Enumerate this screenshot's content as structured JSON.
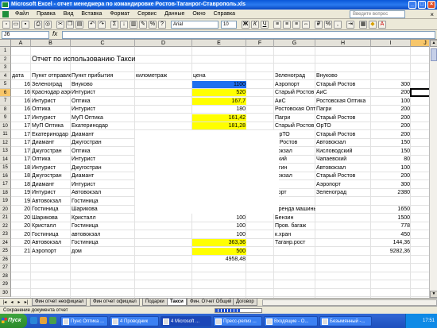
{
  "window": {
    "title": "Microsoft Excel - отчет менеджера по командировке Ростов-Таганрог-Ставрополь.xls"
  },
  "menu": {
    "items": [
      "Файл",
      "Правка",
      "Вид",
      "Вставка",
      "Формат",
      "Сервис",
      "Данные",
      "Окно",
      "Справка"
    ],
    "ask_placeholder": "Введите вопрос"
  },
  "toolbar": {
    "font": "Arial",
    "size": "10"
  },
  "formula": {
    "name_box": "J6",
    "fx": "fx"
  },
  "columns": [
    "A",
    "B",
    "C",
    "D",
    "E",
    "F",
    "G",
    "H",
    "I",
    "J"
  ],
  "rows": [
    "1",
    "2",
    "3",
    "4",
    "5",
    "6",
    "7",
    "8",
    "9",
    "10",
    "11",
    "12",
    "13",
    "14",
    "15",
    "16",
    "17",
    "18",
    "19",
    "20",
    "21",
    "22",
    "23",
    "24",
    "25",
    "26",
    "27",
    "28",
    "29",
    "30"
  ],
  "sheet": {
    "title": "Отчет по использованию Такси",
    "headers": {
      "date": "дата",
      "from": "Пункт отправление",
      "to": "Пункт прибытия",
      "km": "километраж",
      "price": "цена"
    },
    "left_rows": [
      {
        "date": "16",
        "from": "Зеленоград",
        "to": "Внуково",
        "km": "",
        "price": "1100"
      },
      {
        "date": "16",
        "from": "Краснодар аэропорт",
        "to": "Интурист",
        "km": "",
        "price": "520"
      },
      {
        "date": "16",
        "from": "Интурист",
        "to": "Оптика",
        "km": "",
        "price": "167,7"
      },
      {
        "date": "16",
        "from": "Оптика",
        "to": "Интурист",
        "km": "",
        "price": "180"
      },
      {
        "date": "17",
        "from": "Интурист",
        "to": "МуП Оптика",
        "km": "",
        "price": "161,42"
      },
      {
        "date": "17",
        "from": "МуП Оптика",
        "to": "Екатеринодар",
        "km": "",
        "price": "181,28"
      },
      {
        "date": "17",
        "from": "Екатеринодар",
        "to": "Диамант",
        "km": "",
        "price": ""
      },
      {
        "date": "17",
        "from": "Диамант",
        "to": "Джугостран",
        "km": "",
        "price": ""
      },
      {
        "date": "17",
        "from": "Джугостран",
        "to": "Оптика",
        "km": "",
        "price": ""
      },
      {
        "date": "17",
        "from": "Оптика",
        "to": "Интурист",
        "km": "",
        "price": ""
      },
      {
        "date": "18",
        "from": "Интурист",
        "to": "Джугостран",
        "km": "",
        "price": ""
      },
      {
        "date": "18",
        "from": "Джугостран",
        "to": "Диамант",
        "km": "",
        "price": ""
      },
      {
        "date": "18",
        "from": "Диамант",
        "to": "Интурист",
        "km": "",
        "price": ""
      },
      {
        "date": "19",
        "from": "Интурист",
        "to": "Автовокзал",
        "km": "",
        "price": ""
      },
      {
        "date": "19",
        "from": "Автовокзал",
        "to": "Гостиница",
        "km": "",
        "price": ""
      },
      {
        "date": "20",
        "from": "Гостиница",
        "to": "Шарикова",
        "km": "",
        "price": "100"
      },
      {
        "date": "20",
        "from": "Шарикова",
        "to": "Кристалл",
        "km": "",
        "price": "100"
      },
      {
        "date": "20",
        "from": "Кристалл",
        "to": "Гостиница",
        "km": "",
        "price": "100"
      },
      {
        "date": "20",
        "from": "Гостиница",
        "to": "автовокзал",
        "km": "",
        "price": "100"
      },
      {
        "date": "20",
        "from": "Автовокзал",
        "to": "Гостиница",
        "km": "",
        "price": "363,36"
      },
      {
        "date": "21",
        "from": "Аэропорт",
        "to": "дом",
        "km": "",
        "price": "500"
      }
    ],
    "total": "4958,48",
    "right_header": {
      "from": "Зеленоград",
      "to": "Внуково"
    },
    "right_rows": [
      {
        "from": "Аэропорт",
        "to": "Старый Ростов",
        "val": "300"
      },
      {
        "from": "Старый Ростов",
        "to": "АиС",
        "val": "200"
      },
      {
        "from": "АиС",
        "to": "Ростовская Оптика",
        "val": "100"
      },
      {
        "from": "Ростовская Оптика",
        "to": "Пагри",
        "val": "200"
      },
      {
        "from": "Пагри",
        "to": "Старый Ростов",
        "val": "200"
      },
      {
        "from": "Старый Ростов",
        "to": "ОрТО",
        "val": "200"
      },
      {
        "from": "ОрТО",
        "to": "Старый Ростов",
        "val": "200"
      },
      {
        "from": "й Ростов",
        "to": "Автовокзал",
        "val": "150"
      },
      {
        "from": "вокзал",
        "to": "Кисловодский",
        "val": "150"
      },
      {
        "from": "цкий",
        "to": "Чапаевский",
        "val": "80"
      },
      {
        "from": "ыгин",
        "to": "Автовокзал",
        "val": "100"
      },
      {
        "from": "вокзал",
        "to": "Старый Ростов",
        "val": "200"
      },
      {
        "from": "а",
        "to": "Аэропорт",
        "val": "300"
      },
      {
        "from": "порт",
        "to": "Зеленоград",
        "val": "2380"
      },
      {
        "from": "",
        "to": "",
        "val": ""
      },
      {
        "from": "Аренда машины",
        "to": "",
        "val": "1650"
      },
      {
        "from": "Бензин",
        "to": "",
        "val": "1500"
      },
      {
        "from": "Пров. багаж",
        "to": "",
        "val": "778"
      },
      {
        "from": "к.хран",
        "to": "",
        "val": "450"
      },
      {
        "from": "Таганр.рост",
        "to": "",
        "val": "144,36"
      },
      {
        "from": "",
        "to": "",
        "val": "9282,36"
      }
    ]
  },
  "tabs": [
    "Фин отчет неофициал",
    "Фин отчет официал",
    "Подарки",
    "Такси",
    "Фин. Отчет Общий",
    "Договор"
  ],
  "status": {
    "text": "Сохранение документа отчет"
  },
  "taskbar": {
    "start": "Пуск",
    "tasks": [
      "Пунс Оптика ...",
      "4 Проводник",
      "4 Microsoft ...",
      "Пресс-релиз ...",
      "Входящие - О...",
      "Безымянный -..."
    ],
    "clock": "17:51"
  },
  "colors": {
    "accent": "#1f6fef",
    "highlight": "#ffff00",
    "selected_header": "#f7c66a"
  }
}
